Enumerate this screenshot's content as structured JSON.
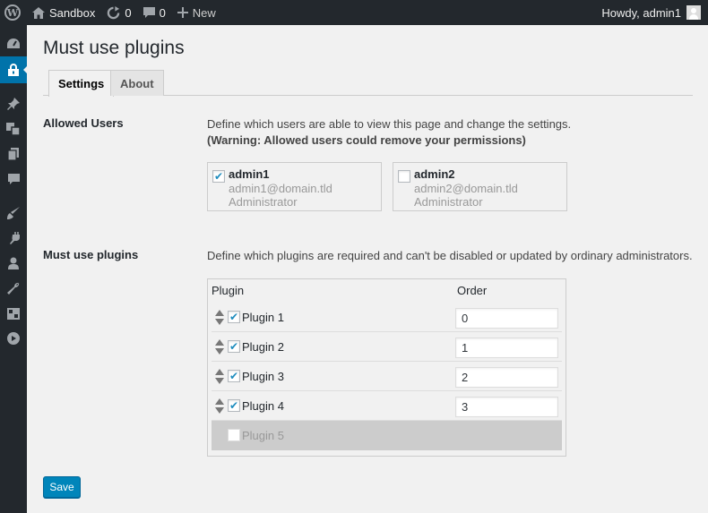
{
  "admin_bar": {
    "site_name": "Sandbox",
    "updates_count": "0",
    "comments_count": "0",
    "new_label": "New",
    "howdy": "Howdy, admin1"
  },
  "side_menu": {
    "icons": [
      "dashboard-icon",
      "lock-icon",
      "pin-icon",
      "media-icon",
      "pages-icon",
      "comments-icon",
      "appearance-icon",
      "plugins-icon",
      "users-icon",
      "tools-icon",
      "settings-icon",
      "play-icon"
    ],
    "current": "lock-icon",
    "accent": "#0073aa"
  },
  "page": {
    "title": "Must use plugins",
    "tabs": [
      {
        "label": "Settings",
        "active": true
      },
      {
        "label": "About",
        "active": false
      }
    ]
  },
  "allowed_users": {
    "label": "Allowed Users",
    "description": "Define which users are able to view this page and change the settings.",
    "warning": "(Warning: Allowed users could remove your permissions)",
    "users": [
      {
        "name": "admin1",
        "email": "admin1@domain.tld",
        "role": "Administrator",
        "checked": true
      },
      {
        "name": "admin2",
        "email": "admin2@domain.tld",
        "role": "Administrator",
        "checked": false
      }
    ]
  },
  "must_use": {
    "label": "Must use plugins",
    "description": "Define which plugins are required and can't be disabled or updated by ordinary administrators.",
    "col_plugin": "Plugin",
    "col_order": "Order",
    "plugins": [
      {
        "name": "Plugin 1",
        "checked": true,
        "order": "0",
        "enabled": true
      },
      {
        "name": "Plugin 2",
        "checked": true,
        "order": "1",
        "enabled": true
      },
      {
        "name": "Plugin 3",
        "checked": true,
        "order": "2",
        "enabled": true
      },
      {
        "name": "Plugin 4",
        "checked": true,
        "order": "3",
        "enabled": true
      },
      {
        "name": "Plugin 5",
        "checked": false,
        "order": "",
        "enabled": false
      }
    ]
  },
  "save_label": "Save",
  "colors": {
    "admin_bar_bg": "#23282d",
    "primary_button": "#0085ba",
    "checkmark": "#1e8cbe"
  }
}
